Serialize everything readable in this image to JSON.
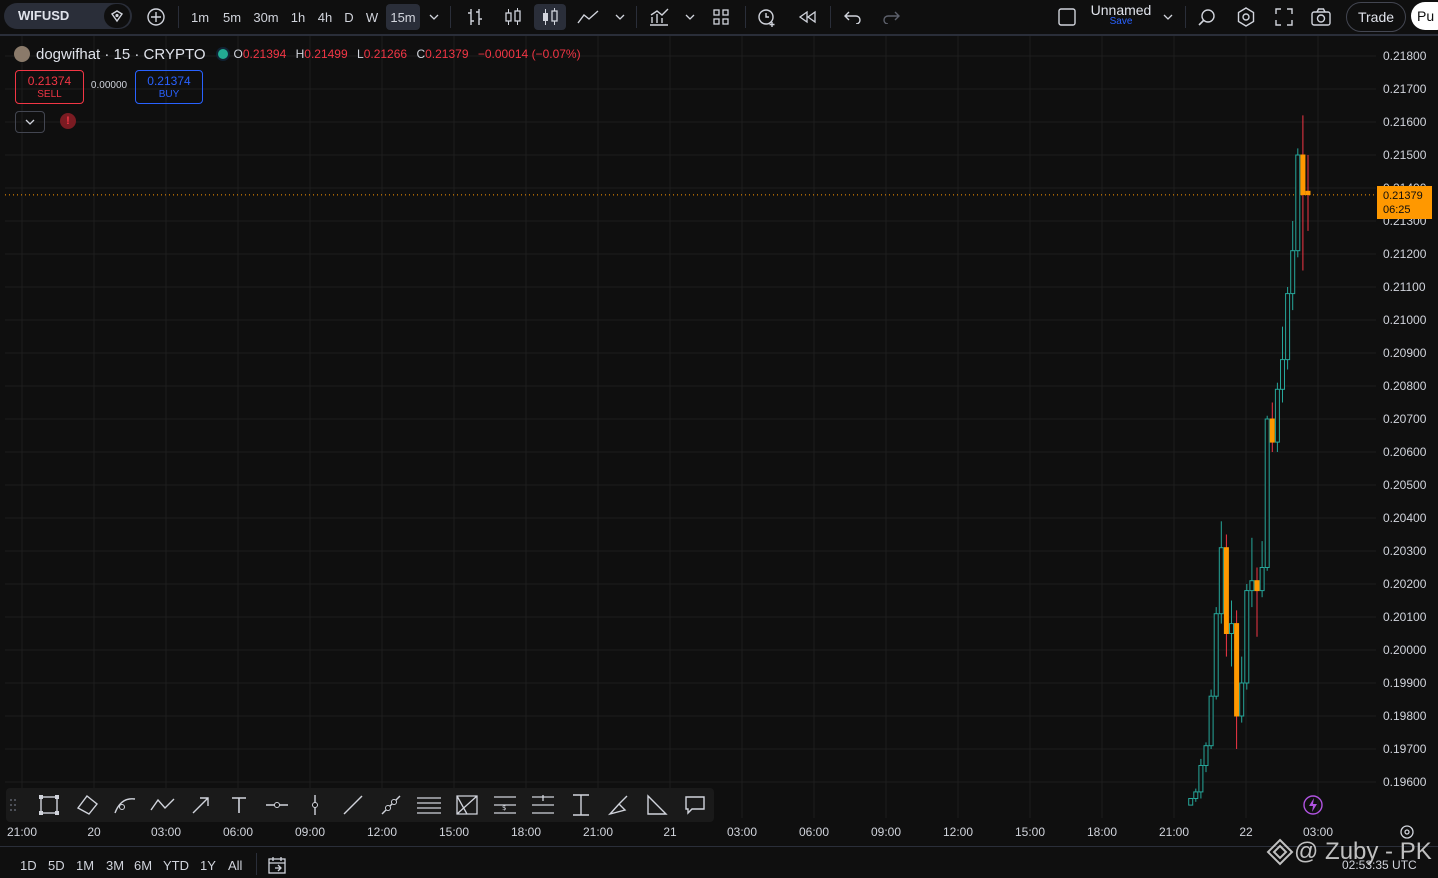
{
  "toolbar": {
    "symbol": "WIFUSD",
    "intervals": [
      "1m",
      "5m",
      "30m",
      "1h",
      "4h",
      "D",
      "W",
      "15m"
    ],
    "active_interval": "15m",
    "layout_name": "Unnamed",
    "save_label": "Save",
    "trade_label": "Trade",
    "publish_label": "Pu"
  },
  "legend": {
    "title": "dogwifhat · 15 · CRYPTO",
    "o_label": "O",
    "o": "0.21394",
    "h_label": "H",
    "h": "0.21499",
    "l_label": "L",
    "l": "0.21266",
    "c_label": "C",
    "c": "0.21379",
    "change": "−0.00014 (−0.07%)"
  },
  "order": {
    "sell_price": "0.21374",
    "sell_label": "SELL",
    "spread": "0.00000",
    "buy_price": "0.21374",
    "buy_label": "BUY"
  },
  "price_axis": {
    "labels": [
      "0.21800",
      "0.21700",
      "0.21600",
      "0.21500",
      "0.21400",
      "0.21300",
      "0.21200",
      "0.21100",
      "0.21000",
      "0.20900",
      "0.20800",
      "0.20700",
      "0.20600",
      "0.20500",
      "0.20400",
      "0.20300",
      "0.20200",
      "0.20100",
      "0.20000",
      "0.19900",
      "0.19800",
      "0.19700",
      "0.19600"
    ],
    "current_price": "0.21379",
    "countdown": "06:25"
  },
  "time_axis": {
    "labels": [
      "21:00",
      "20",
      "03:00",
      "06:00",
      "09:00",
      "12:00",
      "15:00",
      "18:00",
      "21:00",
      "21",
      "03:00",
      "06:00",
      "09:00",
      "12:00",
      "15:00",
      "18:00",
      "21:00",
      "22",
      "03:00"
    ]
  },
  "bottom": {
    "ranges": [
      "1D",
      "5D",
      "1M",
      "3M",
      "6M",
      "YTD",
      "1Y",
      "All"
    ],
    "clock": "02:53:35 UTC",
    "watermark": "@ Zuby - PK"
  },
  "colors": {
    "up": "#26a69a",
    "down": "#ff9800",
    "wick_down": "#f23645",
    "accent": "#2962ff"
  },
  "chart_data": {
    "type": "candlestick",
    "y_range": [
      0.1953,
      0.2188
    ],
    "candles": [
      {
        "o": 0.1953,
        "h": 0.1955,
        "l": 0.1953,
        "c": 0.1955
      },
      {
        "o": 0.1955,
        "h": 0.1958,
        "l": 0.1954,
        "c": 0.1957
      },
      {
        "o": 0.1957,
        "h": 0.1967,
        "l": 0.1955,
        "c": 0.1965
      },
      {
        "o": 0.1965,
        "h": 0.1972,
        "l": 0.1963,
        "c": 0.1971
      },
      {
        "o": 0.1971,
        "h": 0.1988,
        "l": 0.197,
        "c": 0.1986
      },
      {
        "o": 0.1986,
        "h": 0.2013,
        "l": 0.1985,
        "c": 0.2011
      },
      {
        "o": 0.2011,
        "h": 0.2039,
        "l": 0.2008,
        "c": 0.2031
      },
      {
        "o": 0.2031,
        "h": 0.2035,
        "l": 0.1998,
        "c": 0.2005
      },
      {
        "o": 0.2005,
        "h": 0.2015,
        "l": 0.1995,
        "c": 0.2008
      },
      {
        "o": 0.2008,
        "h": 0.2012,
        "l": 0.197,
        "c": 0.198
      },
      {
        "o": 0.198,
        "h": 0.1998,
        "l": 0.1978,
        "c": 0.199
      },
      {
        "o": 0.199,
        "h": 0.202,
        "l": 0.1988,
        "c": 0.2018
      },
      {
        "o": 0.2018,
        "h": 0.2034,
        "l": 0.2013,
        "c": 0.2021
      },
      {
        "o": 0.2021,
        "h": 0.2025,
        "l": 0.2004,
        "c": 0.2018
      },
      {
        "o": 0.2018,
        "h": 0.2033,
        "l": 0.2016,
        "c": 0.2025
      },
      {
        "o": 0.2025,
        "h": 0.2071,
        "l": 0.2024,
        "c": 0.207
      },
      {
        "o": 0.207,
        "h": 0.2075,
        "l": 0.206,
        "c": 0.2063
      },
      {
        "o": 0.2063,
        "h": 0.2081,
        "l": 0.206,
        "c": 0.2079
      },
      {
        "o": 0.2079,
        "h": 0.2098,
        "l": 0.2075,
        "c": 0.2088
      },
      {
        "o": 0.2088,
        "h": 0.211,
        "l": 0.2085,
        "c": 0.2108
      },
      {
        "o": 0.2108,
        "h": 0.213,
        "l": 0.2103,
        "c": 0.2121
      },
      {
        "o": 0.2121,
        "h": 0.2152,
        "l": 0.2119,
        "c": 0.215
      },
      {
        "o": 0.215,
        "h": 0.2162,
        "l": 0.2115,
        "c": 0.2138
      },
      {
        "o": 0.2139,
        "h": 0.215,
        "l": 0.2127,
        "c": 0.2138
      }
    ]
  }
}
